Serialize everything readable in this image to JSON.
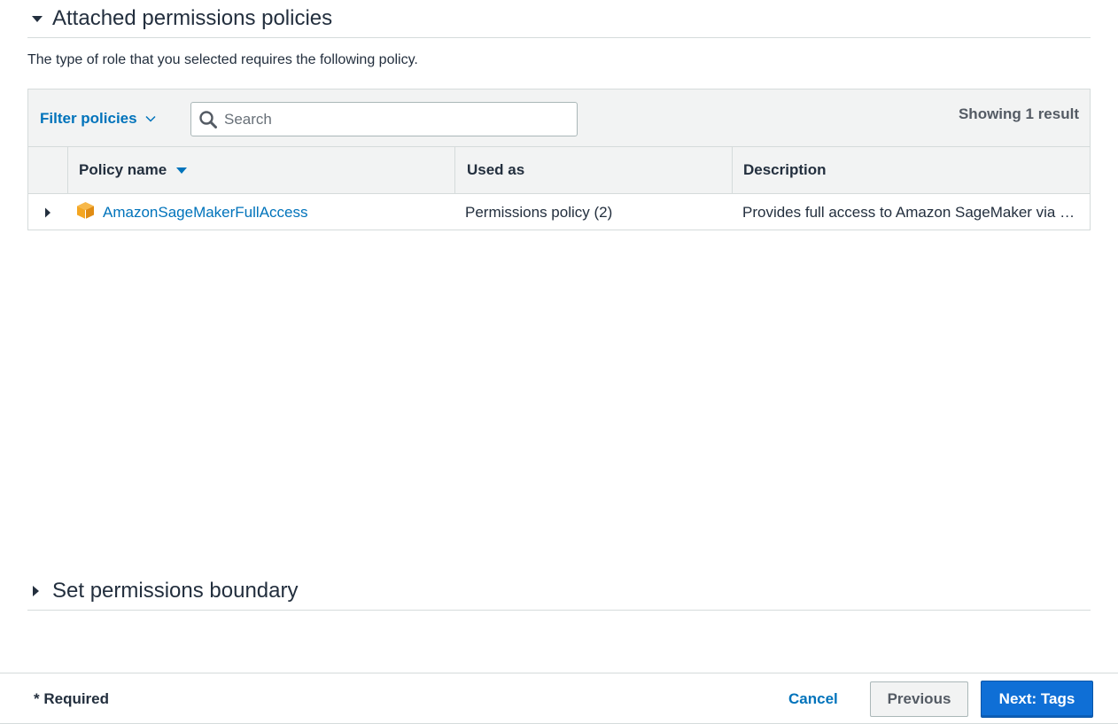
{
  "attached_section": {
    "title": "Attached permissions policies",
    "expanded": true,
    "description": "The type of role that you selected requires the following policy."
  },
  "toolbar": {
    "filter_label": "Filter policies",
    "search_placeholder": "Search",
    "search_value": "",
    "result_count": "Showing 1 result"
  },
  "table": {
    "columns": [
      "Policy name",
      "Used as",
      "Description"
    ],
    "sort_column": "Policy name",
    "rows": [
      {
        "name": "AmazonSageMakerFullAccess",
        "used_as": "Permissions policy (2)",
        "description": "Provides full access to Amazon SageMaker via the AWS Management Console and SDK. Also provides select access to related services (e.g., S3, ECR, CloudWatch Logs).",
        "icon": "aws-managed-policy-icon",
        "expanded": false
      }
    ]
  },
  "boundary_section": {
    "title": "Set permissions boundary",
    "expanded": false
  },
  "footer": {
    "required": "* Required",
    "cancel": "Cancel",
    "previous": "Previous",
    "next": "Next: Tags"
  },
  "colors": {
    "link": "#0073bb",
    "primary_button": "#0f6fd6",
    "policy_icon": "#f4a622"
  }
}
